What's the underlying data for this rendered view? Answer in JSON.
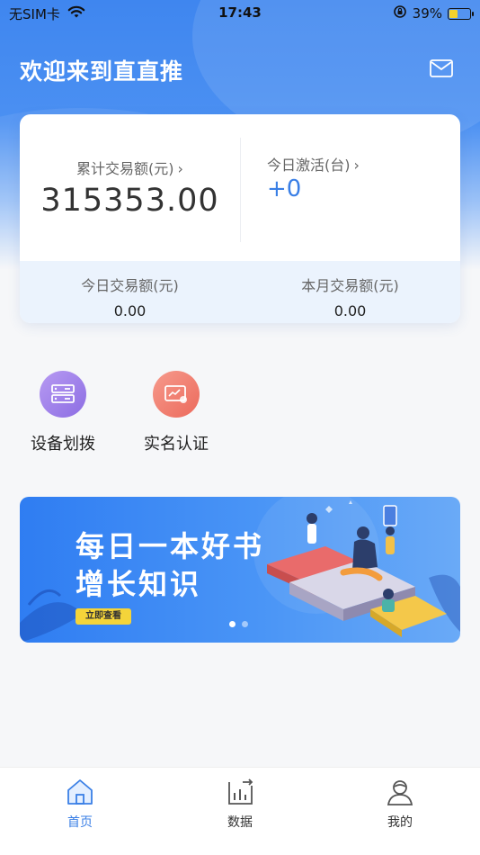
{
  "status_bar": {
    "carrier": "无SIM卡",
    "time": "17:43",
    "battery": "39%",
    "battery_level": 0.39,
    "icons": [
      "wifi-icon",
      "orientation-lock-icon",
      "battery-charging-icon"
    ]
  },
  "header": {
    "title": "欢迎来到直直推",
    "icon": "mail-icon"
  },
  "stats": {
    "total_label": "累计交易额(元)",
    "total_value": "315353.00",
    "activation_label": "今日激活(台)",
    "activation_value": "+0",
    "today_label": "今日交易额(元)",
    "today_value": "0.00",
    "month_label": "本月交易额(元)",
    "month_value": "0.00"
  },
  "quick_actions": [
    {
      "label": "设备划拨",
      "icon": "device-transfer-icon",
      "color": "#9b7be8"
    },
    {
      "label": "实名认证",
      "icon": "id-verification-icon",
      "color": "#f0776a"
    }
  ],
  "banner": {
    "line1": "每日一本好书",
    "line2": "增长知识",
    "button": "立即查看",
    "pages": 2,
    "active_page": 1
  },
  "tab_bar": [
    {
      "label": "首页",
      "icon": "home-icon",
      "active": true
    },
    {
      "label": "数据",
      "icon": "chart-icon",
      "active": false
    },
    {
      "label": "我的",
      "icon": "profile-icon",
      "active": false
    }
  ],
  "colors": {
    "brand": "#3f86ef",
    "accent_value": "#3a7fe6",
    "banner_button": "#f4d43a"
  }
}
